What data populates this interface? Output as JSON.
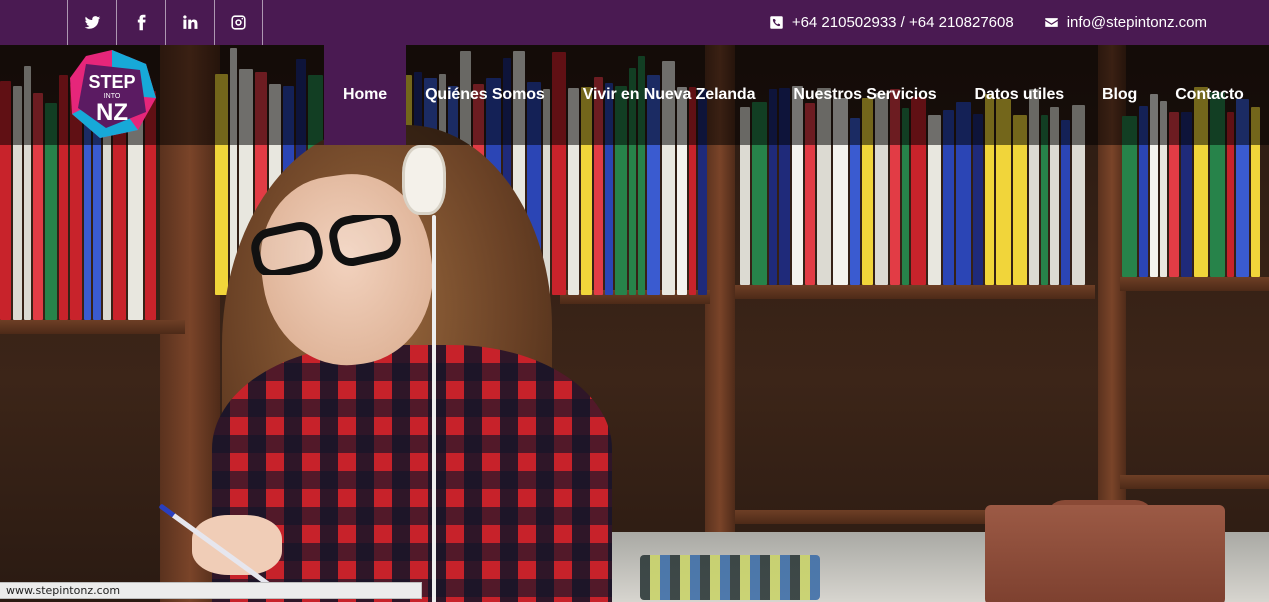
{
  "topbar": {
    "social": [
      {
        "icon": "twitter-icon"
      },
      {
        "icon": "facebook-icon"
      },
      {
        "icon": "linkedin-icon"
      },
      {
        "icon": "instagram-icon"
      }
    ],
    "phone": "+64 210502933 / +64 210827608",
    "email": "info@stepintonz.com",
    "phone_icon": "phone-icon",
    "email_icon": "envelope-icon",
    "bg_color": "#4a1a52"
  },
  "logo": {
    "line1": "STEP",
    "line2": "INTO",
    "line3": "NZ"
  },
  "nav": {
    "items": [
      {
        "label": "Home",
        "active": true
      },
      {
        "label": "Quiénes Somos"
      },
      {
        "label": "Vivir en Nueva Zelanda"
      },
      {
        "label": "Nuestros Servicios"
      },
      {
        "label": "Datos utiles"
      },
      {
        "label": "Blog"
      },
      {
        "label": "Contacto"
      }
    ],
    "active_color": "#4a1a52"
  },
  "status_bar": {
    "url": "www.stepintonz.com"
  }
}
